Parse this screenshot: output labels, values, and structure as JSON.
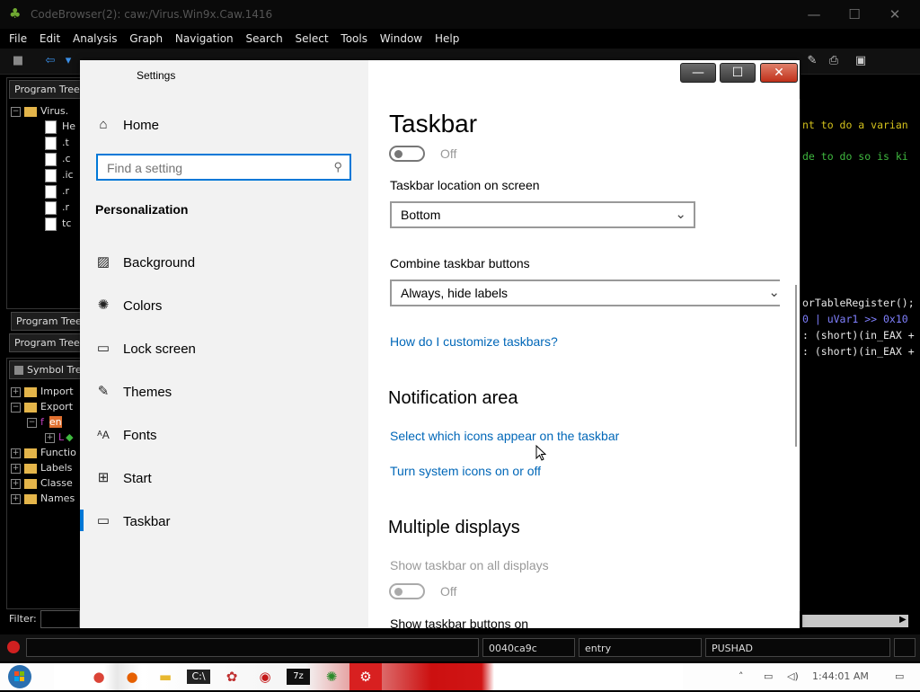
{
  "ghidra": {
    "title": "CodeBrowser(2): caw:/Virus.Win9x.Caw.1416",
    "menu": [
      "File",
      "Edit",
      "Analysis",
      "Graph",
      "Navigation",
      "Search",
      "Select",
      "Tools",
      "Window",
      "Help"
    ],
    "program_trees_tab": "Program Trees",
    "tree_root": "Virus.",
    "tree_items": [
      "He",
      ".t",
      ".c",
      ".ic",
      ".r",
      ".r",
      "tc"
    ],
    "program_tree_tab2": "Program Tree",
    "program_trees_tab3": "Program Trees",
    "symbol_tree_tab": "Symbol Tree",
    "symbols": [
      "Import",
      "Export",
      "en",
      "L",
      "Functio",
      "Labels",
      "Classe",
      "Names"
    ],
    "filter_label": "Filter:",
    "code_lines": [
      {
        "text": "nt to do a varian",
        "color": "#d4c21c"
      },
      {
        "text": "de to do so is ki",
        "color": "#3fb83f"
      },
      {
        "text": "orTableRegister();",
        "color": "#e8e8e8"
      },
      {
        "text": "0 | uVar1 >> 0x10",
        "color": "#8080ff"
      },
      {
        "text": ": (short)(in_EAX +",
        "color": "#e8e8e8"
      },
      {
        "text": ": (short)(in_EAX +",
        "color": "#e8e8e8"
      }
    ],
    "status": {
      "address": "0040ca9c",
      "function": "entry",
      "instruction": "PUSHAD"
    }
  },
  "taskbar": {
    "time": "1:44:01 AM",
    "apps": [
      "chrome",
      "firefox",
      "explorer",
      "cmd",
      "paint",
      "opera",
      "7z",
      "ghidra",
      "settings"
    ]
  },
  "settings": {
    "app_title": "Settings",
    "home_label": "Home",
    "search_placeholder": "Find a setting",
    "section": "Personalization",
    "nav": [
      {
        "label": "Background",
        "icon": "image-icon"
      },
      {
        "label": "Colors",
        "icon": "palette-icon"
      },
      {
        "label": "Lock screen",
        "icon": "lock-screen-icon"
      },
      {
        "label": "Themes",
        "icon": "themes-icon"
      },
      {
        "label": "Fonts",
        "icon": "fonts-icon"
      },
      {
        "label": "Start",
        "icon": "start-icon"
      },
      {
        "label": "Taskbar",
        "icon": "taskbar-icon",
        "active": true
      }
    ],
    "page_title": "Taskbar",
    "toggle1_state": "Off",
    "location_label": "Taskbar location on screen",
    "location_value": "Bottom",
    "combine_label": "Combine taskbar buttons",
    "combine_value": "Always, hide labels",
    "customize_link": "How do I customize taskbars?",
    "notification_heading": "Notification area",
    "notif_link1": "Select which icons appear on the taskbar",
    "notif_link2": "Turn system icons on or off",
    "multiple_heading": "Multiple displays",
    "show_all_label": "Show taskbar on all displays",
    "show_all_state": "Off",
    "show_buttons_label": "Show taskbar buttons on"
  },
  "colors": {
    "accent": "#0078d7",
    "link": "#0067b8",
    "close": "#c0301a"
  }
}
